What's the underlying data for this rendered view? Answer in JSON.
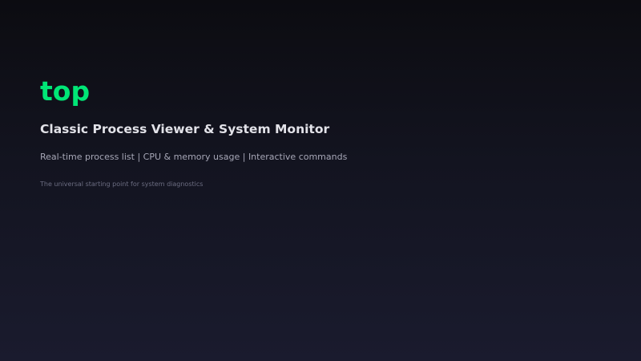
{
  "slide": {
    "title": "top",
    "subtitle": "Classic Process Viewer & System Monitor",
    "features": "Real-time process list | CPU & memory usage | Interactive commands",
    "tagline": "The universal starting point for system diagnostics"
  },
  "colors": {
    "title": "#00e676",
    "subtitle": "#e2e2e8",
    "features": "#a6a7b6",
    "tagline": "#6c6d82",
    "background_top": "#0c0c11",
    "background_bottom": "#1a1b2e"
  }
}
